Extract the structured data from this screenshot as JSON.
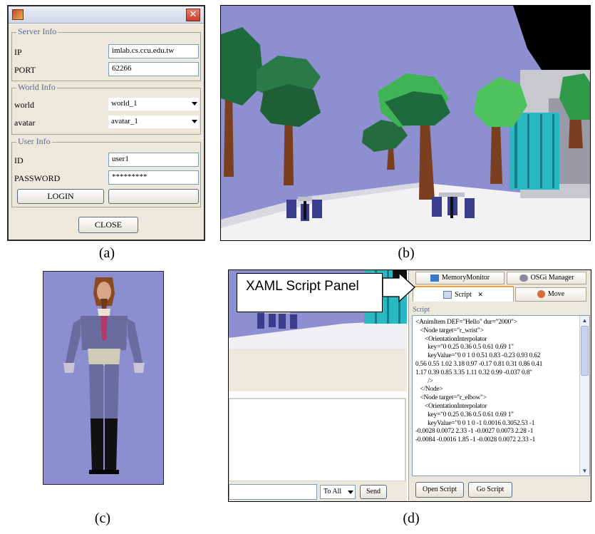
{
  "captions": {
    "a": "(a)",
    "b": "(b)",
    "c": "(c)",
    "d": "(d)"
  },
  "login_dialog": {
    "close_glyph": "✕",
    "server_info": {
      "legend": "Server Info",
      "ip_label": "IP",
      "ip_value": "imlab.cs.ccu.edu.tw",
      "port_label": "PORT",
      "port_value": "62266"
    },
    "world_info": {
      "legend": "World Info",
      "world_label": "world",
      "world_value": "world_1",
      "avatar_label": "avatar",
      "avatar_value": "avatar_1"
    },
    "user_info": {
      "legend": "User Info",
      "id_label": "ID",
      "id_value": "user1",
      "password_label": "PASSWORD",
      "password_value": "*********"
    },
    "login_button": "LOGIN",
    "blank_button": "",
    "close_button": "CLOSE"
  },
  "xaml_window": {
    "callout": "XAML Script Panel",
    "tabs": {
      "memory_monitor": "MemoryMonitor",
      "osgi_manager": "OSGi Manager",
      "script": "Script",
      "script_close": "✕",
      "move": "Move"
    },
    "script_group_label": "Script",
    "script_lines": [
      "<AnimItem DEF=\"Hello\" dur=\"2000\">",
      "   <Node target=\"r_wrist\">",
      "      <OrientationInterpolator",
      "        key=\"0 0.25 0.36 0.5 0.61 0.69 1\"",
      "        keyValue=\"0 0 1 0 0.51 0.83 -0.23 0.93 0.62",
      "0.56 0.55 1.02 3.18 0.97 -0.17 0.81 0.31 0.86 0.41",
      "1.17 0.39 0.85 3.35 1.11 0.32 0.99 -0.037 0.8\"",
      "        />",
      "   </Node>",
      "   <Node target=\"r_elbow\">",
      "      <OrientationInterpolator",
      "        key=\"0 0.25 0.36 0.5 0.61 0.69 1\"",
      "        keyValue=\"0 0 1 0 -1 0.0016 0.3052.53 -1",
      "-0.0028 0.0072 2.33 -1 -0.0027 0.0073 2.28 -1",
      "-0.0084 -0.0016 1.85 -1 -0.0028 0.0072 2.33 -1"
    ],
    "open_script_button": "Open Script",
    "go_script_button": "Go Script",
    "to_select_value": "To All",
    "send_button": "Send"
  },
  "colors": {
    "sky": "#8e8fd0",
    "ground": "#f2f2f5",
    "foliage": "#1f6a3c",
    "foliage_light": "#55c466",
    "trunk": "#7a3f1e",
    "chair": "#3a3c8e",
    "building_cyan": "#2ab9c2"
  }
}
